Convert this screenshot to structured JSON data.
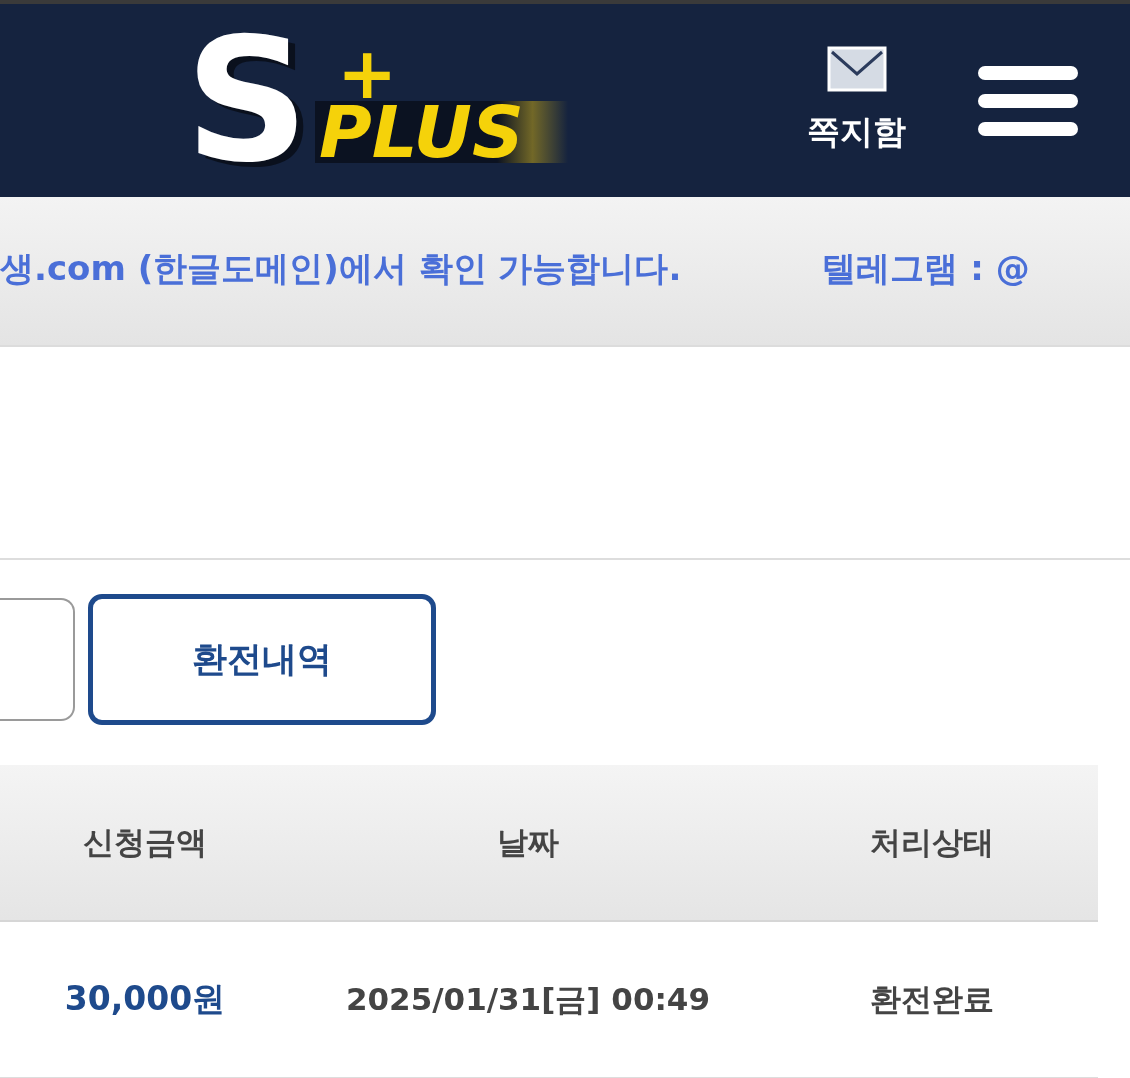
{
  "header": {
    "logo": {
      "letter": "S",
      "plus": "+",
      "word": "PLUS"
    },
    "messages_link": {
      "label": "쪽지함"
    }
  },
  "notice_bar": {
    "messages": [
      "생.com (한글도메인)에서 확인 가능합니다.",
      "텔레그램 : @"
    ]
  },
  "tabs": [
    {
      "selected": false
    },
    {
      "label": "환전내역",
      "selected": true
    }
  ],
  "table": {
    "columns": [
      "신청금액",
      "날짜",
      "처리상태"
    ],
    "rows": [
      {
        "amount": "30,000원",
        "date": "2025/01/31[금] 00:49",
        "status": "환전완료"
      }
    ]
  }
}
